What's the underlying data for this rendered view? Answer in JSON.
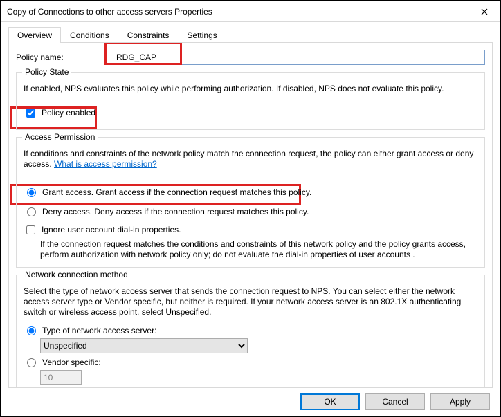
{
  "window": {
    "title": "Copy of Connections to other access servers Properties"
  },
  "tabs": {
    "t0": "Overview",
    "t1": "Conditions",
    "t2": "Constraints",
    "t3": "Settings"
  },
  "policy_name": {
    "label": "Policy name:",
    "value": "RDG_CAP"
  },
  "policy_state": {
    "legend": "Policy State",
    "desc": "If enabled, NPS evaluates this policy while performing authorization. If disabled, NPS does not evaluate this policy.",
    "enabled_label": "Policy enabled"
  },
  "access_permission": {
    "legend": "Access Permission",
    "desc_pre": "If conditions and constraints of the network policy match the connection request, the policy can either grant access or deny access. ",
    "link": "What is access permission?",
    "grant_label": "Grant access. Grant access if the connection request matches this policy.",
    "deny_label": "Deny access. Deny access if the connection request matches this policy.",
    "ignore_label": "Ignore user account dial-in properties.",
    "ignore_desc": "If the connection request matches the conditions and constraints of this network policy and the policy grants access, perform authorization with network policy only; do not evaluate the dial-in properties of user accounts ."
  },
  "ncm": {
    "legend": "Network connection method",
    "desc": "Select the type of network access server that sends the connection request to NPS. You can select either the network access server type or Vendor specific, but neither is required.  If your network access server is an 802.1X authenticating switch or wireless access point, select Unspecified.",
    "type_label": "Type of network access server:",
    "type_value": "Unspecified",
    "vendor_label": "Vendor specific:",
    "vendor_value": "10"
  },
  "buttons": {
    "ok": "OK",
    "cancel": "Cancel",
    "apply": "Apply"
  }
}
